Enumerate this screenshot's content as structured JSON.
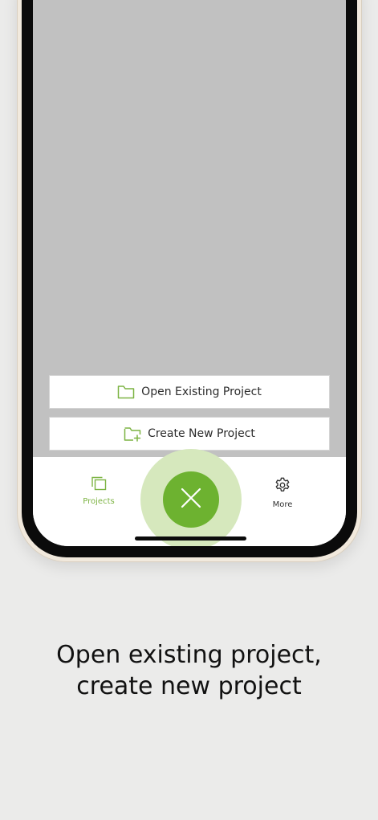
{
  "actions": {
    "open_existing": "Open Existing Project",
    "create_new": "Create New Project"
  },
  "tabbar": {
    "projects_label": "Projects",
    "more_label": "More"
  },
  "caption": {
    "line1": "Open existing project,",
    "line2": "create new project"
  },
  "colors": {
    "accent": "#6db230",
    "accent_soft": "#d6e8bd",
    "overlay": "#c1c1c1",
    "background": "#ebebea"
  },
  "icons": {
    "open_existing": "folder-icon",
    "create_new": "folder-plus-icon",
    "projects_tab": "projects-icon",
    "more_tab": "gear-icon",
    "fab": "close-icon"
  }
}
